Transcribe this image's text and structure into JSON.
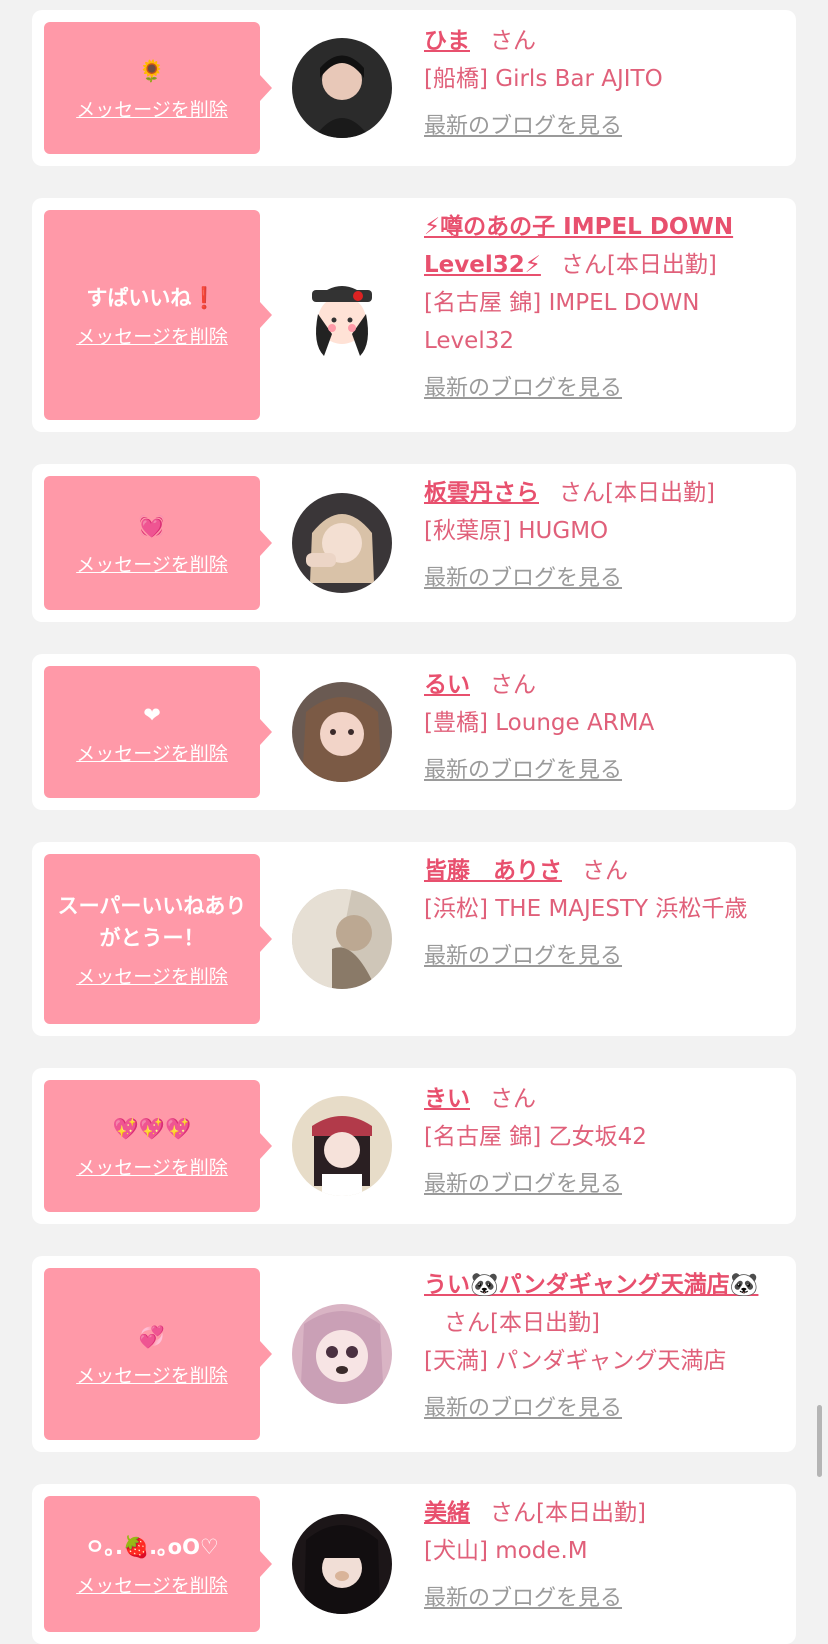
{
  "delete_label": "メッセージを削除",
  "honorific": "さん",
  "blog_label": "最新のブログを見る",
  "colors": {
    "background": "#f2f2f2",
    "bubble": "#ff99a8",
    "accent": "#e8506e",
    "muted": "#9a9a9a"
  },
  "items": [
    {
      "message": "🌻",
      "name": "ひま",
      "status": "",
      "shop": "[船橋] Girls Bar AJITO"
    },
    {
      "message": "すぱいいね❗",
      "name": "⚡噂のあの子 IMPEL DOWN Level32⚡",
      "status": "[本日出勤]",
      "shop": "[名古屋 錦] IMPEL DOWN Level32"
    },
    {
      "message": "💓",
      "name": "板雲丹さら",
      "status": "[本日出勤]",
      "shop": "[秋葉原] HUGMO"
    },
    {
      "message": "❤",
      "name": "るい",
      "status": "",
      "shop": "[豊橋] Lounge ARMA"
    },
    {
      "message": "スーパーいいねありがとうー！",
      "name": "皆藤　ありさ",
      "status": "",
      "shop": "[浜松] THE MAJESTY 浜松千歳"
    },
    {
      "message": "💖💖💖",
      "name": "きい",
      "status": "",
      "shop": "[名古屋 錦] 乙女坂42"
    },
    {
      "message": "💞",
      "name": "うい🐼パンダギャング天満店🐼",
      "status": "[本日出勤]",
      "shop": "[天満] パンダギャング天満店"
    },
    {
      "message": "ㅇ｡.🍓.｡oO♡",
      "name": "美緒",
      "status": "[本日出勤]",
      "shop": "[犬山] mode.M"
    }
  ]
}
